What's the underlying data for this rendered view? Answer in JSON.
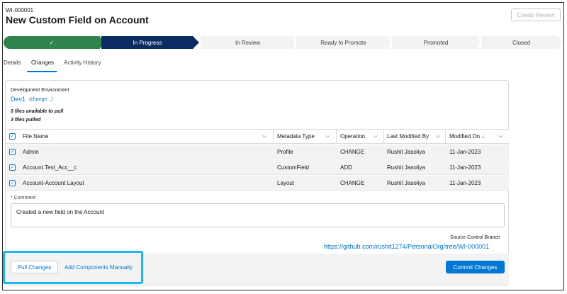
{
  "record": {
    "id": "WI-000001",
    "title": "New Custom Field on Account",
    "create_review_label": "Create Review"
  },
  "path": {
    "stages": [
      {
        "label": "✓",
        "status": "complete"
      },
      {
        "label": "In Progress",
        "status": "current"
      },
      {
        "label": "In Review",
        "status": "upcoming"
      },
      {
        "label": "Ready to Promote",
        "status": "upcoming"
      },
      {
        "label": "Promoted",
        "status": "upcoming"
      },
      {
        "label": "Closed",
        "status": "upcoming"
      }
    ]
  },
  "tabs": [
    {
      "label": "Details"
    },
    {
      "label": "Changes",
      "active": true
    },
    {
      "label": "Activity History"
    }
  ],
  "environment": {
    "label": "Development Environment",
    "name": "Dev1",
    "change_link": "(change...)"
  },
  "stats": {
    "available": "0 files available to pull",
    "pulled": "3 files pulled"
  },
  "table": {
    "columns": [
      "File Name",
      "Metadata Type",
      "Operation",
      "Last Modified By",
      "Modified On ↓"
    ],
    "rows": [
      {
        "file": "Admin",
        "type": "Profile",
        "operation": "CHANGE",
        "modified_by": "Rushit Jasoliya",
        "modified_on": "11-Jan-2023"
      },
      {
        "file": "Account.Test_Acc__c",
        "type": "CustomField",
        "operation": "ADD",
        "modified_by": "Rushit Jasoliya",
        "modified_on": "11-Jan-2023"
      },
      {
        "file": "Account-Account Layout",
        "type": "Layout",
        "operation": "CHANGE",
        "modified_by": "Rushit Jasoliya",
        "modified_on": "11-Jan-2023"
      }
    ]
  },
  "comment": {
    "required_mark": "*",
    "label": "Comment",
    "value": "Created a new field on the Account"
  },
  "source_control": {
    "label": "Source Control Branch",
    "url": "https://github.com/rushit1274/PersonalOrg/tree/WI-000001"
  },
  "footer": {
    "pull_label": "Pull Changes",
    "add_label": "Add Components Manually",
    "commit_label": "Commit Changes"
  },
  "colors": {
    "complete": "#2e844a",
    "current": "#0b2c62",
    "brand": "#0176d3",
    "highlight": "#1fb6f5"
  }
}
